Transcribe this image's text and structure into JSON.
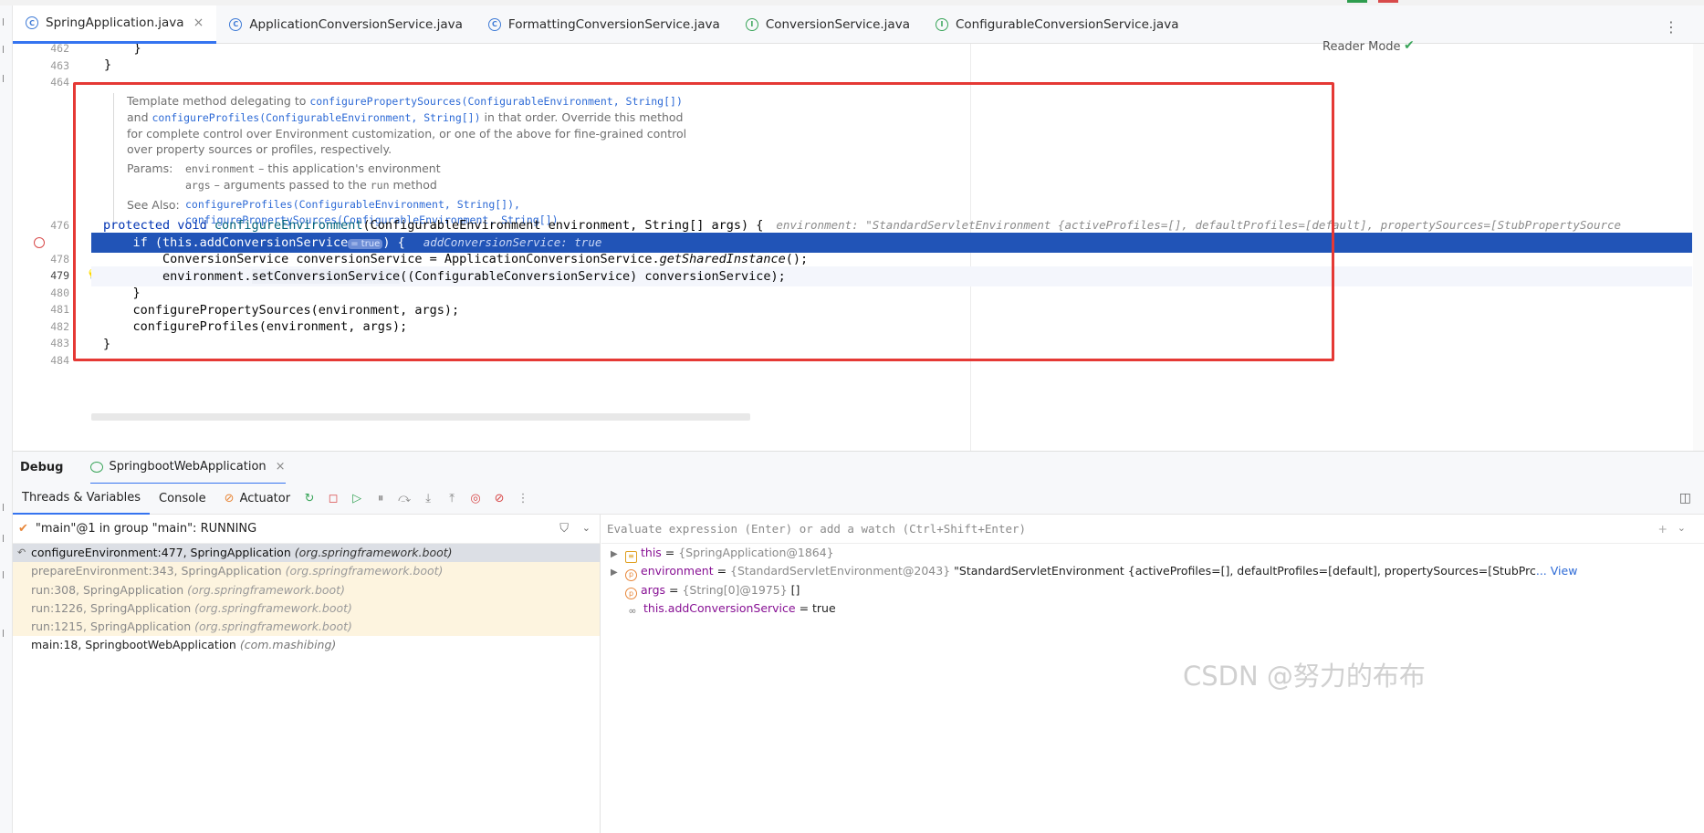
{
  "tabs": [
    {
      "label": "SpringApplication.java",
      "icon": "class-icon",
      "active": true,
      "closable": true
    },
    {
      "label": "ApplicationConversionService.java",
      "icon": "class-icon"
    },
    {
      "label": "FormattingConversionService.java",
      "icon": "class-icon"
    },
    {
      "label": "ConversionService.java",
      "icon": "interface-icon"
    },
    {
      "label": "ConfigurableConversionService.java",
      "icon": "interface-icon"
    }
  ],
  "editor": {
    "reader_mode": "Reader Mode",
    "line_numbers": {
      "l462": "462",
      "l463": "463",
      "l464": "464",
      "l476": "476",
      "l478": "478",
      "l479": "479",
      "l480": "480",
      "l481": "481",
      "l482": "482",
      "l483": "483",
      "l484": "484"
    },
    "code": {
      "l462": "    }",
      "l463": "}",
      "l476_kw": "protected void ",
      "l476_fn": "configureEnvironment",
      "l476_rest": "(ConfigurableEnvironment environment, String[] args) {",
      "l476_hint": "environment: \"StandardServletEnvironment {activeProfiles=[], defaultProfiles=[default], propertySources=[StubPropertySource",
      "l477_a": "    if (this.addConversionService",
      "l477_badge": "= true",
      "l477_b": ") {",
      "l477_hint": "addConversionService: true",
      "l478_a": "        ConversionService conversionService = ApplicationConversionService.",
      "l478_b": "getSharedInstance",
      "l478_c": "();",
      "l479_a": "        environment.",
      "l479_b": "setConversionService",
      "l479_c": "((ConfigurableConversionService) conversionService);",
      "l480": "    }",
      "l481_a": "    ",
      "l481_b": "configurePropertySources",
      "l481_c": "(environment, args);",
      "l482_a": "    ",
      "l482_b": "configureProfiles",
      "l482_c": "(environment, args);",
      "l483": "}"
    },
    "doc": {
      "line1_pre": "Template method delegating to ",
      "line1_link": "configurePropertySources(ConfigurableEnvironment, String[])",
      "line2_pre": "and ",
      "line2_link": "configureProfiles(ConfigurableEnvironment, String[])",
      "line2_post": " in that order. Override this method",
      "line3": "for complete control over Environment customization, or one of the above for fine-grained control",
      "line4": "over property sources or profiles, respectively.",
      "params_label": "Params:",
      "param1_name": "environment",
      "param1_desc": " – this application's environment",
      "param2_name": "args",
      "param2_desc": " – arguments passed to the ",
      "param2_code": "run",
      "param2_post": " method",
      "see_label": "See Also:",
      "see1": "configureProfiles(ConfigurableEnvironment, String[]),",
      "see2": "configurePropertySources(ConfigurableEnvironment, String[])"
    }
  },
  "debug": {
    "title": "Debug",
    "run_tab": "SpringbootWebApplication",
    "tabs": [
      "Threads & Variables",
      "Console",
      "Actuator"
    ],
    "thread": "\"main\"@1 in group \"main\": RUNNING",
    "frames": [
      {
        "method": "configureEnvironment:477, SpringApplication",
        "pkg": "(org.springframework.boot)",
        "kind": "sel"
      },
      {
        "method": "prepareEnvironment:343, SpringApplication",
        "pkg": "(org.springframework.boot)",
        "kind": "lib"
      },
      {
        "method": "run:308, SpringApplication",
        "pkg": "(org.springframework.boot)",
        "kind": "lib"
      },
      {
        "method": "run:1226, SpringApplication",
        "pkg": "(org.springframework.boot)",
        "kind": "lib"
      },
      {
        "method": "run:1215, SpringApplication",
        "pkg": "(org.springframework.boot)",
        "kind": "lib"
      },
      {
        "method": "main:18, SpringbootWebApplication",
        "pkg": "(com.mashibing)",
        "kind": "app"
      }
    ],
    "eval_placeholder": "Evaluate expression (Enter) or add a watch (Ctrl+Shift+Enter)",
    "vars": [
      {
        "name": "this",
        "eq": " = ",
        "type": "{SpringApplication@1864}",
        "val": "",
        "view": ""
      },
      {
        "name": "environment",
        "eq": " = ",
        "type": "{StandardServletEnvironment@2043}",
        "val": " \"StandardServletEnvironment {activeProfiles=[], defaultProfiles=[default], propertySources=[StubPrc",
        "view": "... View"
      },
      {
        "name": "args",
        "eq": " = ",
        "type": "{String[0]@1975}",
        "val": " []",
        "view": ""
      },
      {
        "name": "this.addConversionService",
        "eq": " = ",
        "type": "",
        "val": "true",
        "view": ""
      }
    ]
  },
  "watermark": "CSDN @努力的布布"
}
